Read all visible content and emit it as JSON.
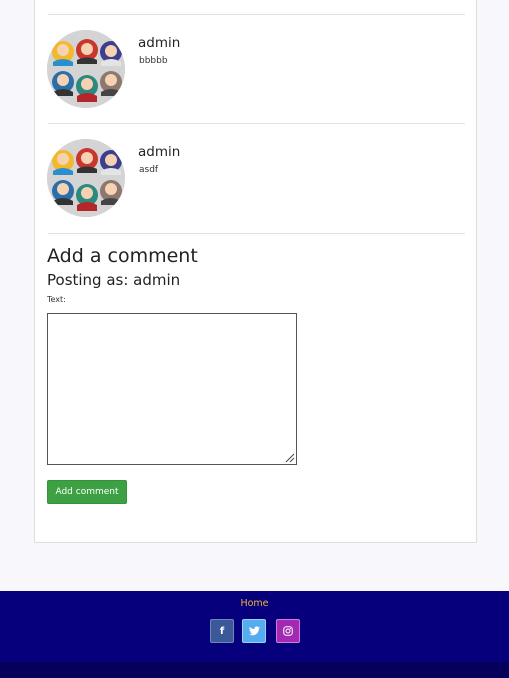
{
  "comments": [
    {
      "author": "admin",
      "text": "bbbbb"
    },
    {
      "author": "admin",
      "text": "asdf"
    }
  ],
  "form": {
    "title": "Add a comment",
    "posting_as": "Posting as: admin",
    "text_label": "Text:",
    "textarea_value": "",
    "submit_label": "Add comment"
  },
  "footer": {
    "home_link": "Home",
    "social_icons": [
      "facebook-icon",
      "twitter-icon",
      "instagram-icon"
    ]
  },
  "colors": {
    "submit_button": "#3da043",
    "footer_background": "#07007c",
    "footer_link": "#f0b43a",
    "facebook": "#3b5998",
    "twitter": "#55acee",
    "instagram": "#a12ab0"
  }
}
